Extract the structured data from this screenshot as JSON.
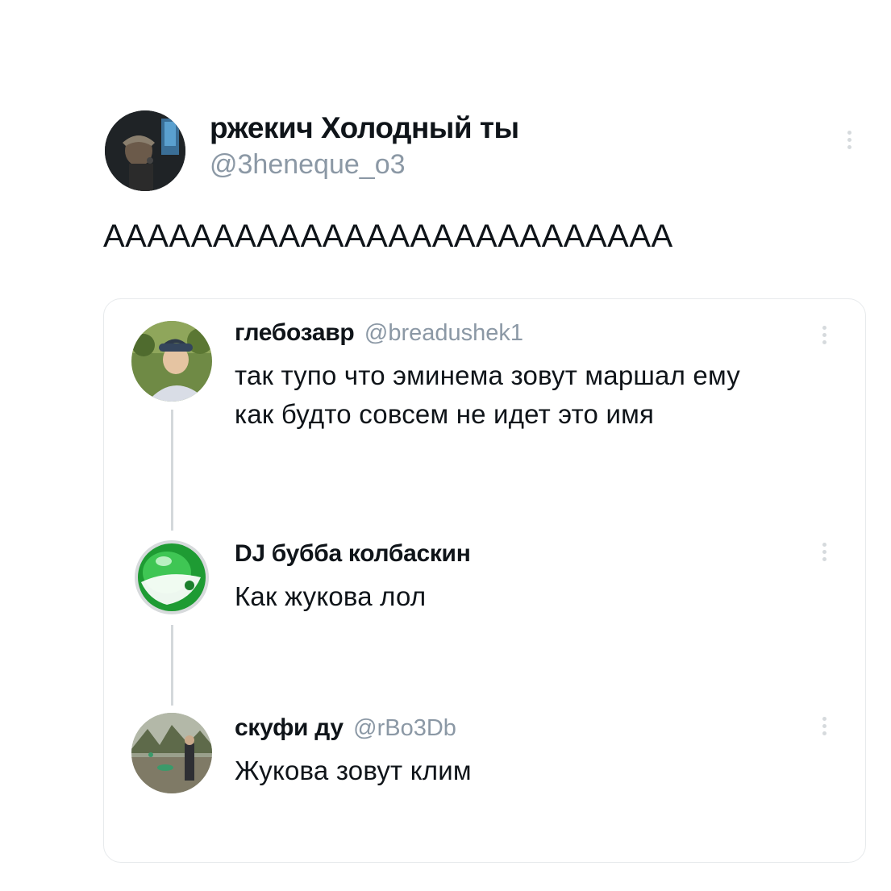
{
  "main_tweet": {
    "author_name": "ржекич Холодный ты",
    "author_handle": "@3heneque_o3",
    "text": "АААААААААААААААААААААААААА"
  },
  "thread": [
    {
      "author_name": "глебозавр",
      "author_handle": "@breadushek1",
      "text": "так тупо что эминема зовут маршал ему\nкак будто совсем не идет это имя"
    },
    {
      "author_name": "DJ бубба колбаскин",
      "author_handle": "",
      "text": "Как жукова лол"
    },
    {
      "author_name": "скуфи ду",
      "author_handle": "@rBo3Db",
      "text": "Жукова зовут клим"
    }
  ],
  "icons": {
    "more_menu": "more-vertical-icon"
  },
  "colors": {
    "text_primary": "#0f1419",
    "text_secondary": "#8b98a5",
    "border": "#e7eaec",
    "thread_line": "#d4d8db",
    "background": "#ffffff"
  }
}
